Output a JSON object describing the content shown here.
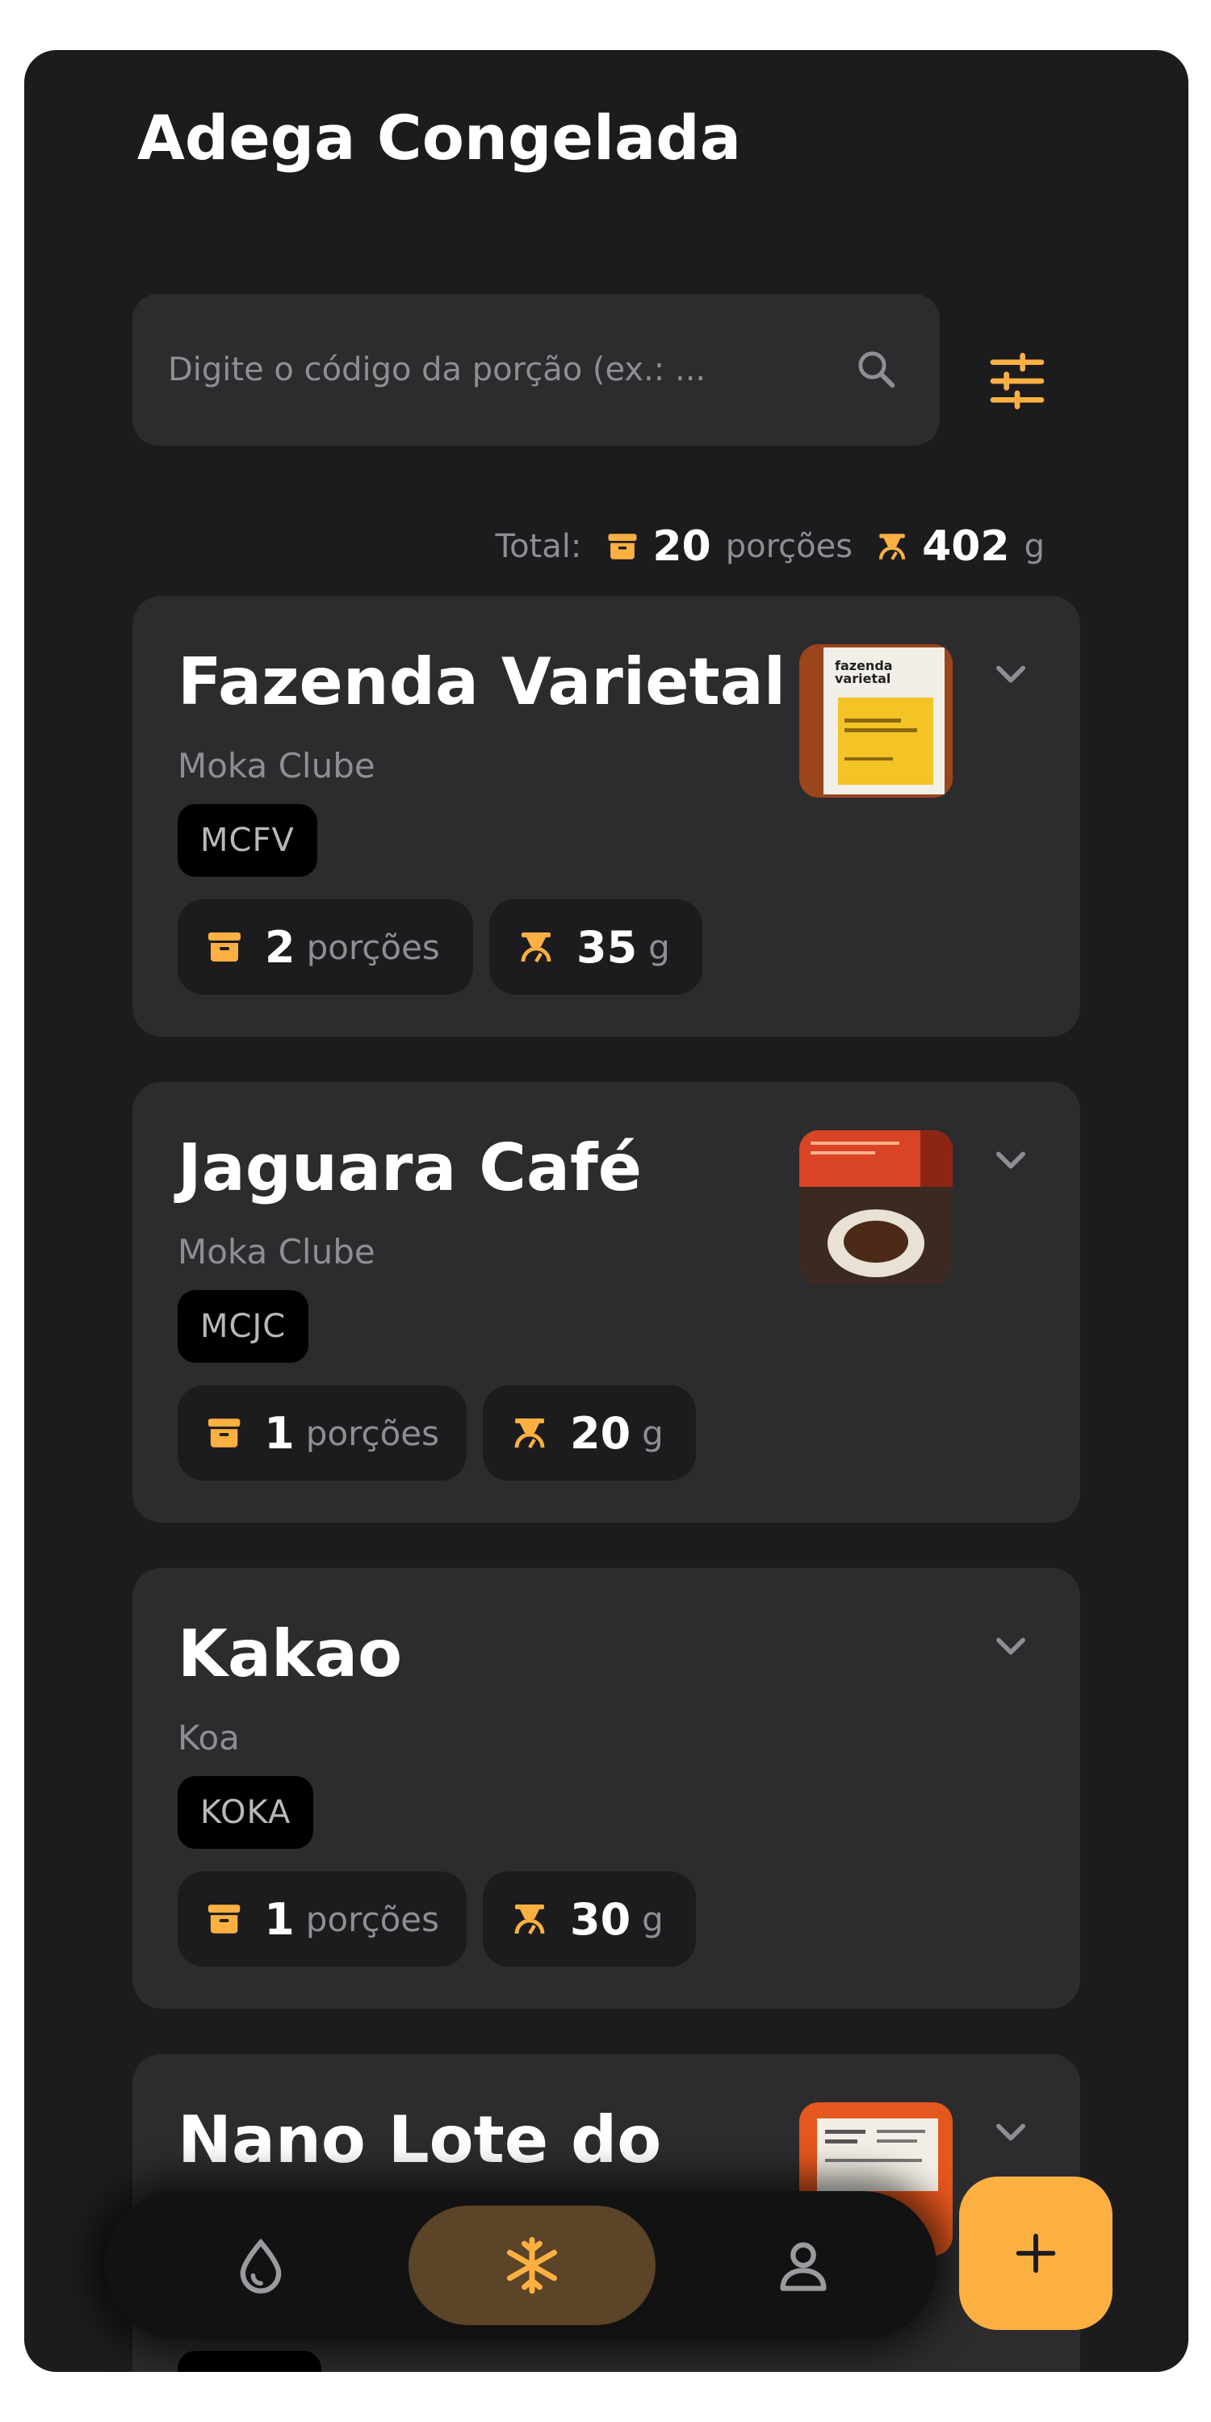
{
  "app": {
    "title": "Adega Congelada",
    "accent_color": "#fdb042"
  },
  "search": {
    "placeholder": "Digite o código da porção (ex.: ...",
    "value": ""
  },
  "totals": {
    "label": "Total:",
    "portions": "20",
    "portions_unit": "porções",
    "grams": "402",
    "grams_unit": "g"
  },
  "cards": [
    {
      "name": "Fazenda Varietal",
      "roaster": "Moka Clube",
      "code": "MCFV",
      "portions": "2",
      "portions_unit": "porções",
      "grams": "35",
      "grams_unit": "g",
      "has_image": true,
      "image_text": [
        "fazenda",
        "varietal"
      ]
    },
    {
      "name": "Jaguara Café",
      "roaster": "Moka Clube",
      "code": "MCJC",
      "portions": "1",
      "portions_unit": "porções",
      "grams": "20",
      "grams_unit": "g",
      "has_image": true
    },
    {
      "name": "Kakao",
      "roaster": "Koa",
      "code": "KOKA",
      "portions": "1",
      "portions_unit": "porções",
      "grams": "30",
      "grams_unit": "g",
      "has_image": false
    },
    {
      "name": "Nano Lote do",
      "has_image": true
    }
  ],
  "nav": {
    "items": [
      {
        "icon": "drop-icon",
        "active": false
      },
      {
        "icon": "snowflake-icon",
        "active": true
      },
      {
        "icon": "person-icon",
        "active": false
      }
    ],
    "fab_icon": "plus-icon"
  }
}
